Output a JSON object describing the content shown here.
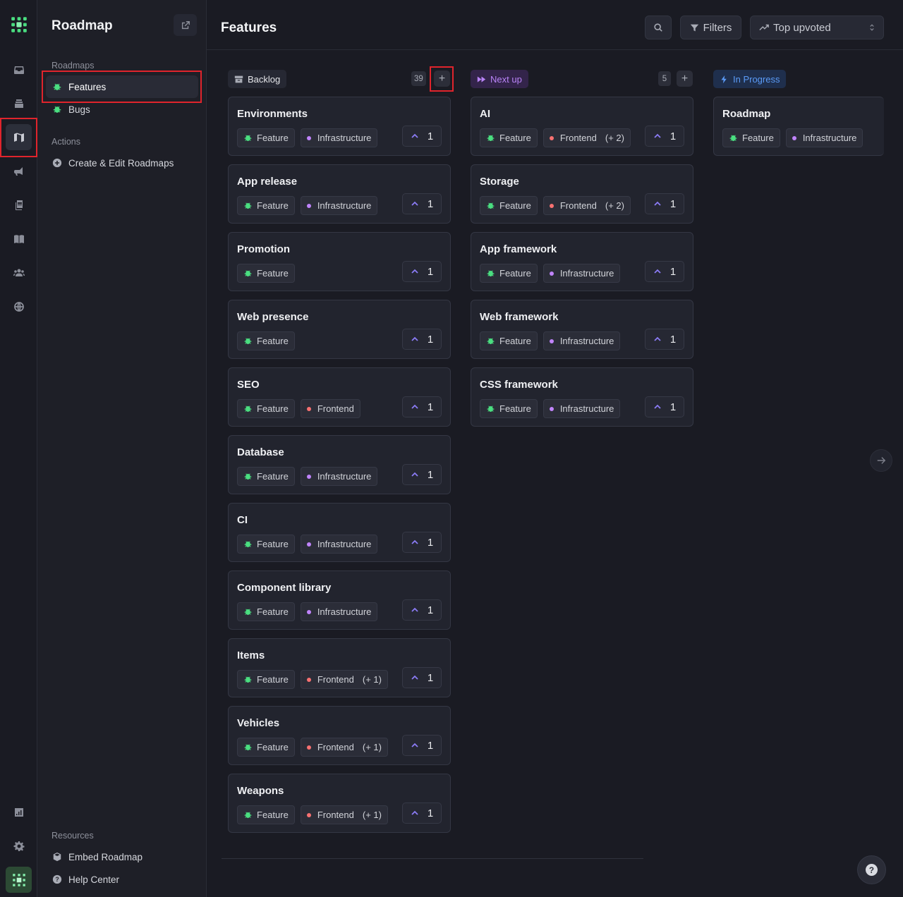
{
  "sidebar": {
    "title": "Roadmap",
    "roadmaps_heading": "Roadmaps",
    "roadmaps": [
      {
        "label": "Features",
        "icon": "feature-bug-icon"
      },
      {
        "label": "Bugs",
        "icon": "bug-icon"
      }
    ],
    "actions_heading": "Actions",
    "actions": [
      {
        "label": "Create & Edit Roadmaps",
        "icon": "plus-circle-icon"
      }
    ],
    "resources_heading": "Resources",
    "resources": [
      {
        "label": "Embed Roadmap",
        "icon": "cube-icon"
      },
      {
        "label": "Help Center",
        "icon": "question-circle-icon"
      }
    ]
  },
  "header": {
    "title": "Features",
    "filters_label": "Filters",
    "sort_label": "Top upvoted"
  },
  "colors": {
    "backlog": "#a9acb6",
    "next_up": "#a855f7",
    "in_progress": "#3b82f6",
    "infrastructure_dot": "#c084fc",
    "frontend_dot": "#f87171",
    "feature_icon": "#4ade80",
    "vote_arrow": "#8b7cf6",
    "highlight": "#e0242c"
  },
  "columns": [
    {
      "name": "Backlog",
      "count": "39",
      "cards": [
        {
          "title": "Environments",
          "tag2": "Infrastructure",
          "tag2_color": "#c084fc",
          "extra": "",
          "votes": "1"
        },
        {
          "title": "App release",
          "tag2": "Infrastructure",
          "tag2_color": "#c084fc",
          "extra": "",
          "votes": "1"
        },
        {
          "title": "Promotion",
          "tag2": "",
          "tag2_color": "",
          "extra": "",
          "votes": "1"
        },
        {
          "title": "Web presence",
          "tag2": "",
          "tag2_color": "",
          "extra": "",
          "votes": "1"
        },
        {
          "title": "SEO",
          "tag2": "Frontend",
          "tag2_color": "#f87171",
          "extra": "",
          "votes": "1"
        },
        {
          "title": "Database",
          "tag2": "Infrastructure",
          "tag2_color": "#c084fc",
          "extra": "",
          "votes": "1"
        },
        {
          "title": "CI",
          "tag2": "Infrastructure",
          "tag2_color": "#c084fc",
          "extra": "",
          "votes": "1"
        },
        {
          "title": "Component library",
          "tag2": "Infrastructure",
          "tag2_color": "#c084fc",
          "extra": "",
          "votes": "1"
        },
        {
          "title": "Items",
          "tag2": "Frontend",
          "tag2_color": "#f87171",
          "extra": "(+ 1)",
          "votes": "1"
        },
        {
          "title": "Vehicles",
          "tag2": "Frontend",
          "tag2_color": "#f87171",
          "extra": "(+ 1)",
          "votes": "1"
        },
        {
          "title": "Weapons",
          "tag2": "Frontend",
          "tag2_color": "#f87171",
          "extra": "(+ 1)",
          "votes": "1"
        }
      ]
    },
    {
      "name": "Next up",
      "count": "5",
      "cards": [
        {
          "title": "AI",
          "tag2": "Frontend",
          "tag2_color": "#f87171",
          "extra": "(+ 2)",
          "votes": "1"
        },
        {
          "title": "Storage",
          "tag2": "Frontend",
          "tag2_color": "#f87171",
          "extra": "(+ 2)",
          "votes": "1"
        },
        {
          "title": "App framework",
          "tag2": "Infrastructure",
          "tag2_color": "#c084fc",
          "extra": "",
          "votes": "1"
        },
        {
          "title": "Web framework",
          "tag2": "Infrastructure",
          "tag2_color": "#c084fc",
          "extra": "",
          "votes": "1"
        },
        {
          "title": "CSS framework",
          "tag2": "Infrastructure",
          "tag2_color": "#c084fc",
          "extra": "",
          "votes": "1"
        }
      ]
    },
    {
      "name": "In Progress",
      "count": "",
      "cards": [
        {
          "title": "Roadmap",
          "tag2": "Infrastructure",
          "tag2_color": "#c084fc",
          "extra": "",
          "votes": ""
        }
      ]
    }
  ],
  "tag1_label": "Feature"
}
